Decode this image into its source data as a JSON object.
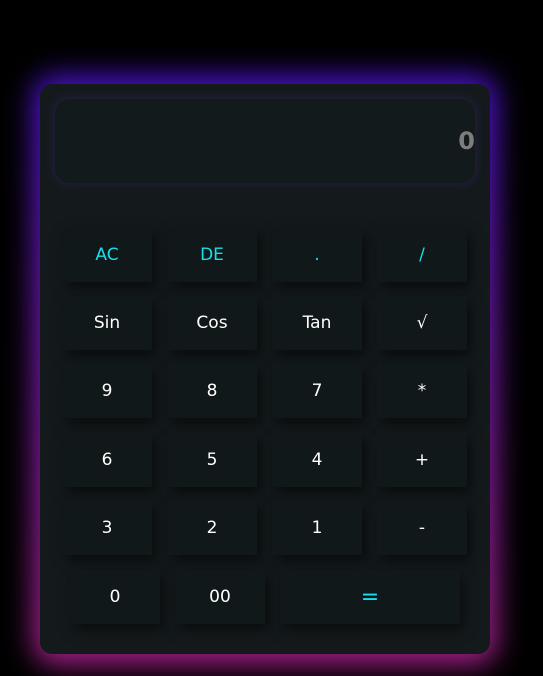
{
  "display": {
    "value": "0"
  },
  "buttons": [
    {
      "label": "AC",
      "accent": true
    },
    {
      "label": "DE",
      "accent": true
    },
    {
      "label": ".",
      "accent": true
    },
    {
      "label": "/",
      "accent": true
    },
    {
      "label": "Sin"
    },
    {
      "label": "Cos"
    },
    {
      "label": "Tan"
    },
    {
      "label": "√"
    },
    {
      "label": "9"
    },
    {
      "label": "8"
    },
    {
      "label": "7"
    },
    {
      "label": "*"
    },
    {
      "label": "6"
    },
    {
      "label": "5"
    },
    {
      "label": "4"
    },
    {
      "label": "+"
    },
    {
      "label": "3"
    },
    {
      "label": "2"
    },
    {
      "label": "1"
    },
    {
      "label": "-"
    },
    {
      "label": "0"
    },
    {
      "label": "00"
    },
    {
      "label": "=",
      "accent": true
    }
  ],
  "colors": {
    "accent": "#16e0ee",
    "glow_top": "#4a12d0",
    "glow_bottom": "#a8208a",
    "body": "#141a1c"
  }
}
